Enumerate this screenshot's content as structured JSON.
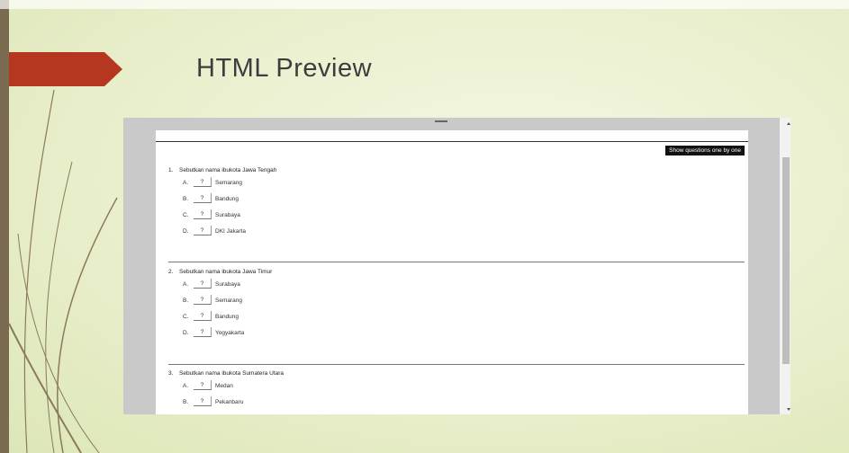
{
  "slide": {
    "title": "HTML Preview",
    "accent_color": "#b5371f",
    "bar_color": "#7a6a4f"
  },
  "viewer": {
    "show_button_label": "Show questions one by one"
  },
  "questions": [
    {
      "number": "1.",
      "stem": "Sebutkan nama ibukota Jawa Tengah",
      "options": [
        {
          "letter": "A.",
          "box": "?",
          "text": "Semarang"
        },
        {
          "letter": "B.",
          "box": "?",
          "text": "Bandung"
        },
        {
          "letter": "C.",
          "box": "?",
          "text": "Surabaya"
        },
        {
          "letter": "D.",
          "box": "?",
          "text": "DKI Jakarta"
        }
      ]
    },
    {
      "number": "2.",
      "stem": "Sebutkan nama ibukota Jawa Timur",
      "options": [
        {
          "letter": "A.",
          "box": "?",
          "text": "Surabaya"
        },
        {
          "letter": "B.",
          "box": "?",
          "text": "Semarang"
        },
        {
          "letter": "C.",
          "box": "?",
          "text": "Bandung"
        },
        {
          "letter": "D.",
          "box": "?",
          "text": "Yogyakarta"
        }
      ]
    },
    {
      "number": "3.",
      "stem": "Sebutkan nama ibukota Sumatera Utara",
      "options": [
        {
          "letter": "A.",
          "box": "?",
          "text": "Medan"
        },
        {
          "letter": "B.",
          "box": "?",
          "text": "Pekanbaru"
        }
      ]
    }
  ]
}
